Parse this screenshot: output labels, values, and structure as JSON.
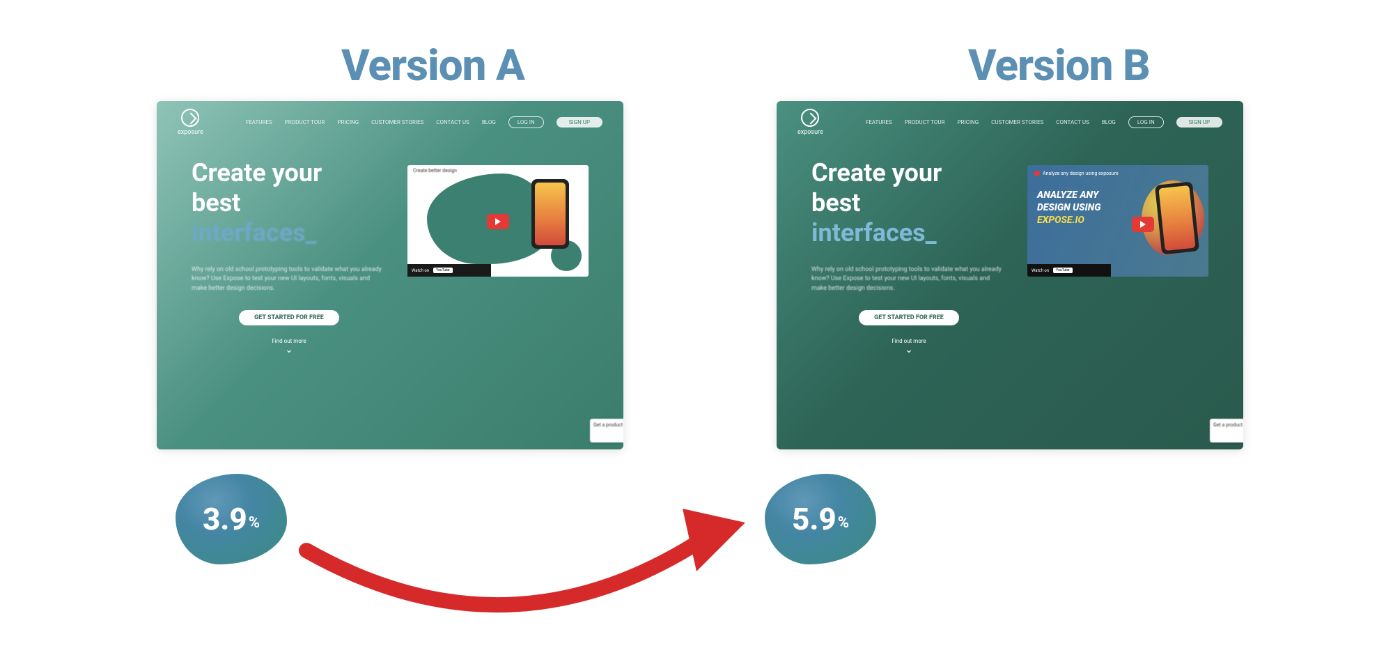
{
  "labels": {
    "version_a": "Version A",
    "version_b": "Version B"
  },
  "results": {
    "a_value": "3.9",
    "a_unit": "%",
    "b_value": "5.9",
    "b_unit": "%"
  },
  "panel": {
    "brand": "exposure",
    "nav": {
      "item1": "FEATURES",
      "item2": "PRODUCT TOUR",
      "item3": "PRICING",
      "item4": "CUSTOMER STORIES",
      "item5": "CONTACT US",
      "item6": "BLOG",
      "login": "LOG IN",
      "signup": "SIGN UP"
    },
    "headline_line1": "Create your",
    "headline_line2": "best",
    "headline_accent": "interfaces_",
    "subtext": "Why rely on old school prototyping tools to validate what you already know? Use Expose to test your new UI layouts, fonts, visuals and make better design decisions.",
    "cta": "GET STARTED FOR FREE",
    "scroll_label": "Find out more",
    "watch_label": "Watch on",
    "watch_brand": "YouTube",
    "corner_tag": "Get a product tour"
  },
  "video_a": {
    "title": "Create better design"
  },
  "video_b": {
    "title": "Analyze any design using exposure",
    "line1": "ANALYZE ANY",
    "line2": "DESIGN USING",
    "line3": "EXPOSE.IO"
  },
  "colors": {
    "label_blue": "#5b8fb3",
    "panel_a_grad": "#4a9080",
    "panel_b_grad": "#2d6456",
    "blob_teal": "#3b8a82",
    "arrow_red": "#d62a2a"
  }
}
